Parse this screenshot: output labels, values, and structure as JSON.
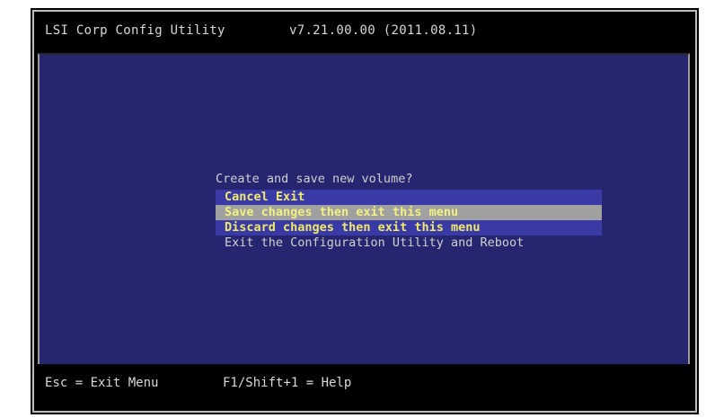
{
  "header": {
    "title": "LSI Corp Config Utility",
    "version": "v7.21.00.00 (2011.08.11)"
  },
  "dialog": {
    "prompt": "Create and save new volume?",
    "options": [
      {
        "label": "Cancel Exit",
        "state": "normal"
      },
      {
        "label": "Save changes then exit this menu",
        "state": "selected"
      },
      {
        "label": "Discard changes then exit this menu",
        "state": "normal"
      },
      {
        "label": "Exit the Configuration Utility and Reboot",
        "state": "plain"
      }
    ]
  },
  "footer": {
    "esc_hint": "Esc = Exit Menu",
    "help_hint": "F1/Shift+1 = Help"
  },
  "colors": {
    "background_blue": "#262670",
    "highlight_text": "#f0ea6a",
    "selection_bar": "#a0a0a0"
  }
}
